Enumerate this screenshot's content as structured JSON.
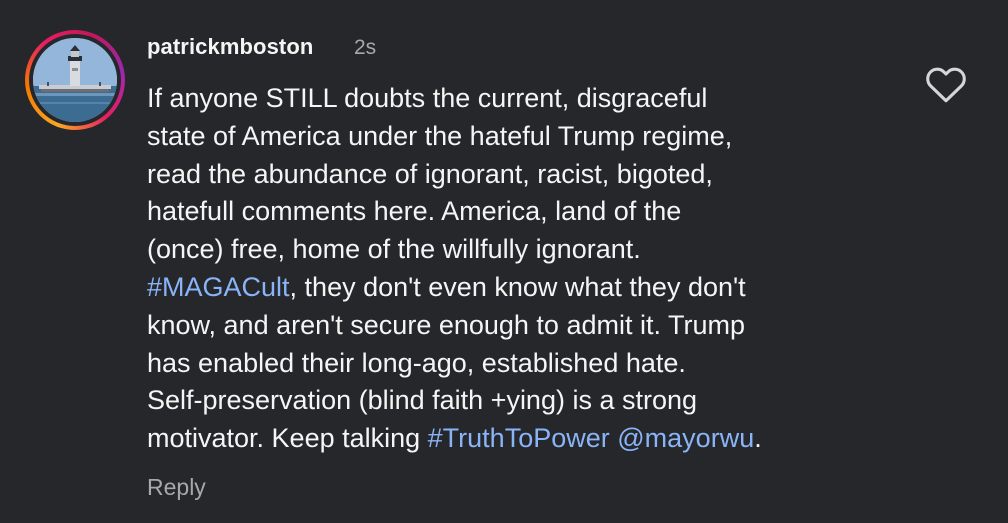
{
  "comment": {
    "username": "patrickmboston",
    "timestamp": "2s",
    "lines": [
      [
        {
          "text": "If anyone STILL doubts the current, disgraceful"
        }
      ],
      [
        {
          "text": "state of America under the hateful Trump regime,"
        }
      ],
      [
        {
          "text": "read the abundance of ignorant, racist, bigoted,"
        }
      ],
      [
        {
          "text": "hatefull comments here. America, land of the"
        }
      ],
      [
        {
          "text": "(once) free, home of the willfully ignorant."
        }
      ],
      [
        {
          "text": "#MAGACult",
          "link": true
        },
        {
          "text": ", they don't even know what they don't"
        }
      ],
      [
        {
          "text": "know, and aren't secure enough to admit it. Trump"
        }
      ],
      [
        {
          "text": "has enabled their long-ago, established hate."
        }
      ],
      [
        {
          "text": "Self-preservation (blind faith +ying) is a strong"
        }
      ],
      [
        {
          "text": "motivator. Keep talking "
        },
        {
          "text": "#TruthToPower",
          "link": true
        },
        {
          "text": " "
        },
        {
          "text": "@mayorwu",
          "link": true
        },
        {
          "text": "."
        }
      ]
    ],
    "reply_label": "Reply",
    "like_icon": "heart-outline-icon"
  },
  "colors": {
    "background": "#26272b",
    "text": "#f5f5f5",
    "muted": "#a8a8a8",
    "link": "#8ab4f8",
    "story_ring": [
      "#f9a825",
      "#e91e63",
      "#9c27b0"
    ]
  }
}
